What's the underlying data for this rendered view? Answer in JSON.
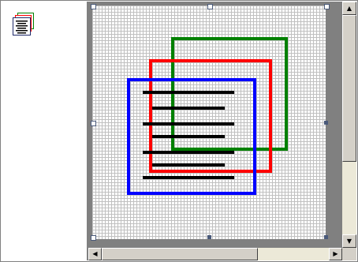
{
  "preview": {
    "icon": "document-stack-icon"
  },
  "canvas": {
    "grid": true,
    "icon_name": "document-stack-icon",
    "colors": {
      "back_page": "#008000",
      "middle_page": "#ff0000",
      "front_page": "#0000ff",
      "text_lines": "#000000",
      "grid_line": "#c0c0c0",
      "handle": "#4a5a7a"
    }
  },
  "scrollbars": {
    "vertical": {
      "up": "▲",
      "down": "▼",
      "position": 0.0
    },
    "horizontal": {
      "left": "◀",
      "right": "▶",
      "position": 0.0
    }
  }
}
